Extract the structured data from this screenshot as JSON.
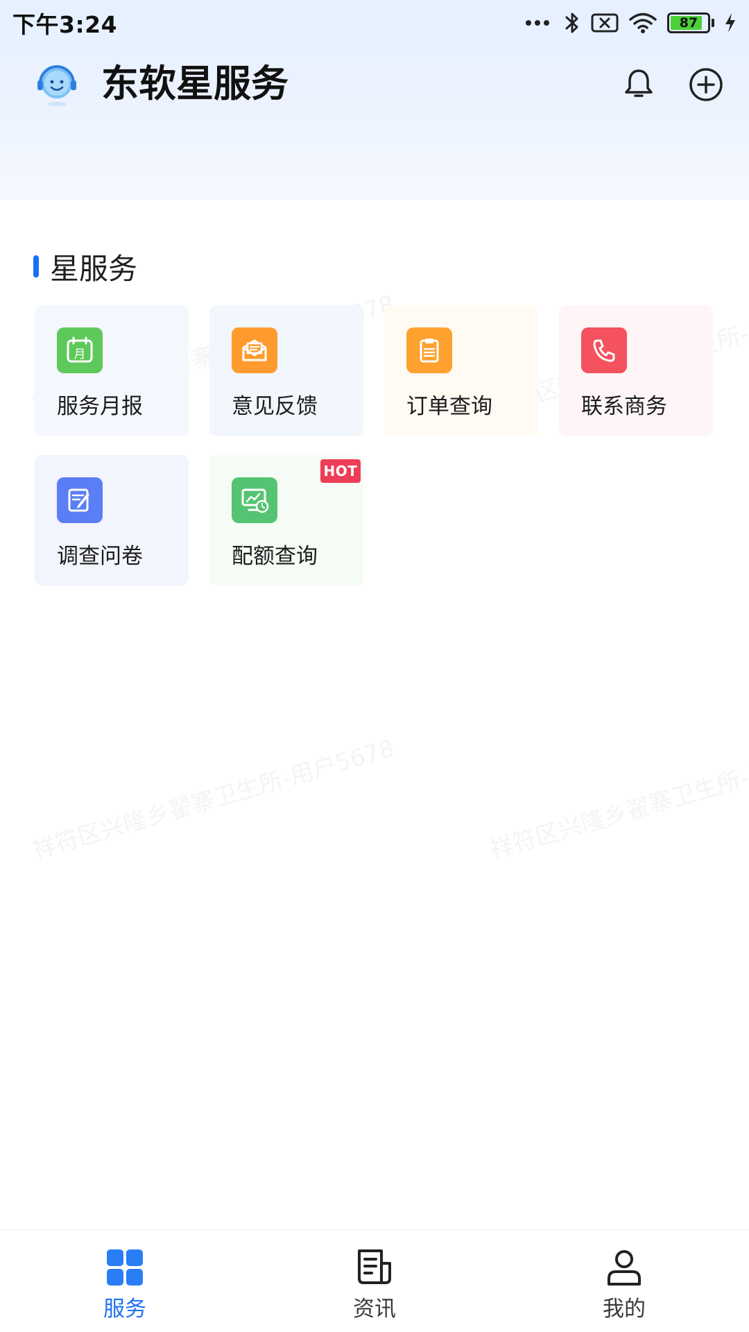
{
  "status_bar": {
    "time": "下午3:24",
    "battery": "87"
  },
  "header": {
    "title": "东软星服务",
    "logo_icon": "customer-service-headset-icon",
    "bell_icon": "bell-icon",
    "add_icon": "plus-circle-icon"
  },
  "section": {
    "title": "星服务",
    "accent_color": "#1a6ff5"
  },
  "services": [
    {
      "label": "服务月报",
      "icon": "calendar-icon",
      "icon_color": "#5fc85a",
      "tile_color": "#f4f7fd",
      "hot": false
    },
    {
      "label": "意见反馈",
      "icon": "envelope-icon",
      "icon_color": "#ff9b2e",
      "tile_color": "#f2f6fd",
      "hot": false
    },
    {
      "label": "订单查询",
      "icon": "clipboard-icon",
      "icon_color": "#ffa12e",
      "tile_color": "#fffbf3",
      "hot": false
    },
    {
      "label": "联系商务",
      "icon": "phone-icon",
      "icon_color": "#f4525f",
      "tile_color": "#fff5f6",
      "hot": false
    },
    {
      "label": "调查问卷",
      "icon": "survey-edit-icon",
      "icon_color": "#5b7ef5",
      "tile_color": "#f2f4fe",
      "hot": false
    },
    {
      "label": "配额查询",
      "icon": "monitor-clock-icon",
      "icon_color": "#55c472",
      "tile_color": "#f5fcf5",
      "hot": true,
      "badge": "HOT"
    }
  ],
  "watermark": "祥符区兴隆乡翟寨卫生所-用户5678",
  "bottom_nav": [
    {
      "label": "服务",
      "icon": "grid-icon",
      "active": true
    },
    {
      "label": "资讯",
      "icon": "news-icon",
      "active": false
    },
    {
      "label": "我的",
      "icon": "user-icon",
      "active": false
    }
  ]
}
